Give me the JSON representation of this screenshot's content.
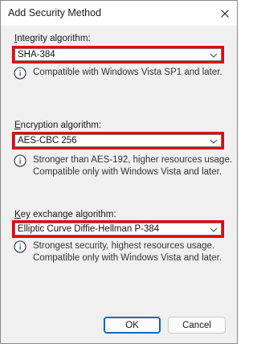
{
  "window": {
    "title": "Add Security Method"
  },
  "integrity": {
    "label_accel": "I",
    "label_rest": "ntegrity algorithm:",
    "value": "SHA-384",
    "info": "Compatible with Windows Vista SP1 and later."
  },
  "encryption": {
    "label_accel": "E",
    "label_rest": "ncryption algorithm:",
    "value": "AES-CBC 256",
    "info_line1": "Stronger than AES-192, higher resources usage.",
    "info_line2": "Compatible only with Windows Vista and later."
  },
  "key_exchange": {
    "label_accel": "K",
    "label_rest": "ey exchange algorithm:",
    "value": "Elliptic Curve Diffie-Hellman P-384",
    "info_line1": "Strongest security, highest resources usage.",
    "info_line2": "Compatible only with Windows Vista and later."
  },
  "buttons": {
    "ok": "OK",
    "cancel": "Cancel"
  },
  "colors": {
    "highlight_border": "#e8000b",
    "accent": "#0067c0",
    "dialog_bg": "#f0f0f0"
  },
  "icons": {
    "close": "close-icon",
    "dropdown": "chevron-down-icon",
    "info": "info-icon"
  }
}
